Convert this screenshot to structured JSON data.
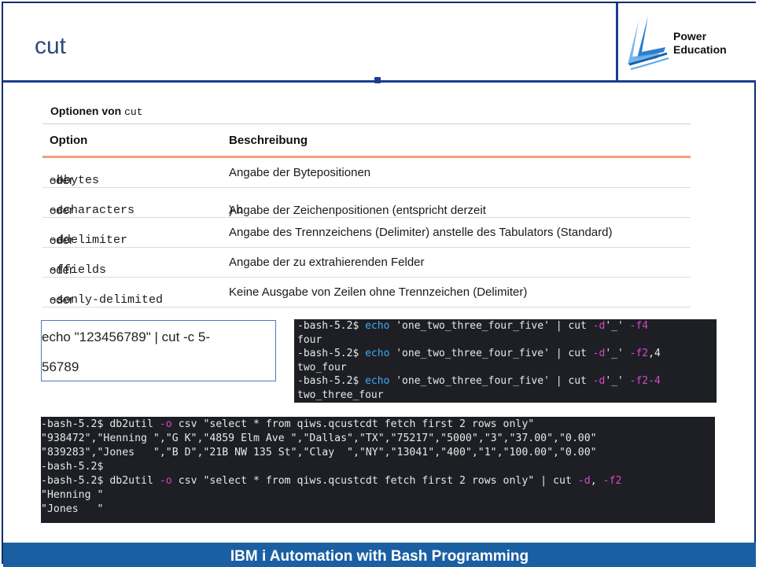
{
  "slide": {
    "title": "cut",
    "logo": {
      "line1": "Power",
      "line2": "Education"
    }
  },
  "table": {
    "caption_prefix": "Optionen von ",
    "caption_code": "cut",
    "headers": [
      "Option",
      "Beschreibung"
    ],
    "rows": [
      {
        "short": "-b",
        "sep": " oder ",
        "long": "--bytes",
        "desc": "Angabe der Bytepositionen",
        "desc_code": "",
        "desc_end": ""
      },
      {
        "short": "-c",
        "sep": " oder ",
        "long": "--characters",
        "desc": "Angabe der Zeichenpositionen (entspricht derzeit ",
        "desc_code": "-b",
        "desc_end": ")"
      },
      {
        "short": "-d",
        "sep": " oder ",
        "long": "--delimiter",
        "desc": "Angabe des Trennzeichens (Delimiter) anstelle des Tabulators (Standard)",
        "desc_code": "",
        "desc_end": ""
      },
      {
        "short": "-f",
        "sep": " oder ",
        "long": "--fields",
        "desc": "Angabe der zu extrahierenden Felder",
        "desc_code": "",
        "desc_end": ""
      },
      {
        "short": "-s",
        "sep": " oder ",
        "long": "--only-delimited",
        "desc": "Keine Ausgabe von Zeilen ohne Trennzeichen (Delimiter)",
        "desc_code": "",
        "desc_end": ""
      }
    ]
  },
  "example": {
    "command": "echo \"123456789\" | cut -c 5-",
    "output": "56789"
  },
  "terminal1": {
    "prompt": "-bash-5.2$ ",
    "echo": "echo",
    "str": " 'one_two_three_four_five' | cut ",
    "flag_d": "-d",
    "delim": "'_' ",
    "cmd1_flag": "-f4",
    "cmd1_out": "four",
    "cmd2_flag": "-f2",
    "cmd2_tail": ",4",
    "cmd2_out": "two_four",
    "cmd3_flag": "-f2-4",
    "cmd3_out": "two_three_four"
  },
  "terminal2": {
    "cmd_a1": "-bash-5.2$ db2util ",
    "flag_o": "-o",
    "cmd_a2": " csv \"select * from qiws.qcustcdt fetch first 2 rows only\"",
    "row1": "\"938472\",\"Henning \",\"G K\",\"4859 Elm Ave \",\"Dallas\",\"TX\",\"75217\",\"5000\",\"3\",\"37.00\",\"0.00\"",
    "row2": "\"839283\",\"Jones   \",\"B D\",\"21B NW 135 St\",\"Clay  \",\"NY\",\"13041\",\"400\",\"1\",\"100.00\",\"0.00\"",
    "empty_prompt": "-bash-5.2$",
    "cmd_b2": " csv \"select * from qiws.qcustcdt fetch first 2 rows only\" | cut ",
    "flag_d": "-d",
    "comma": ", ",
    "flag_f2": "-f2",
    "out1": "\"Henning \"",
    "out2": "\"Jones   \""
  },
  "footer": {
    "text": "IBM i Automation with Bash Programming"
  }
}
